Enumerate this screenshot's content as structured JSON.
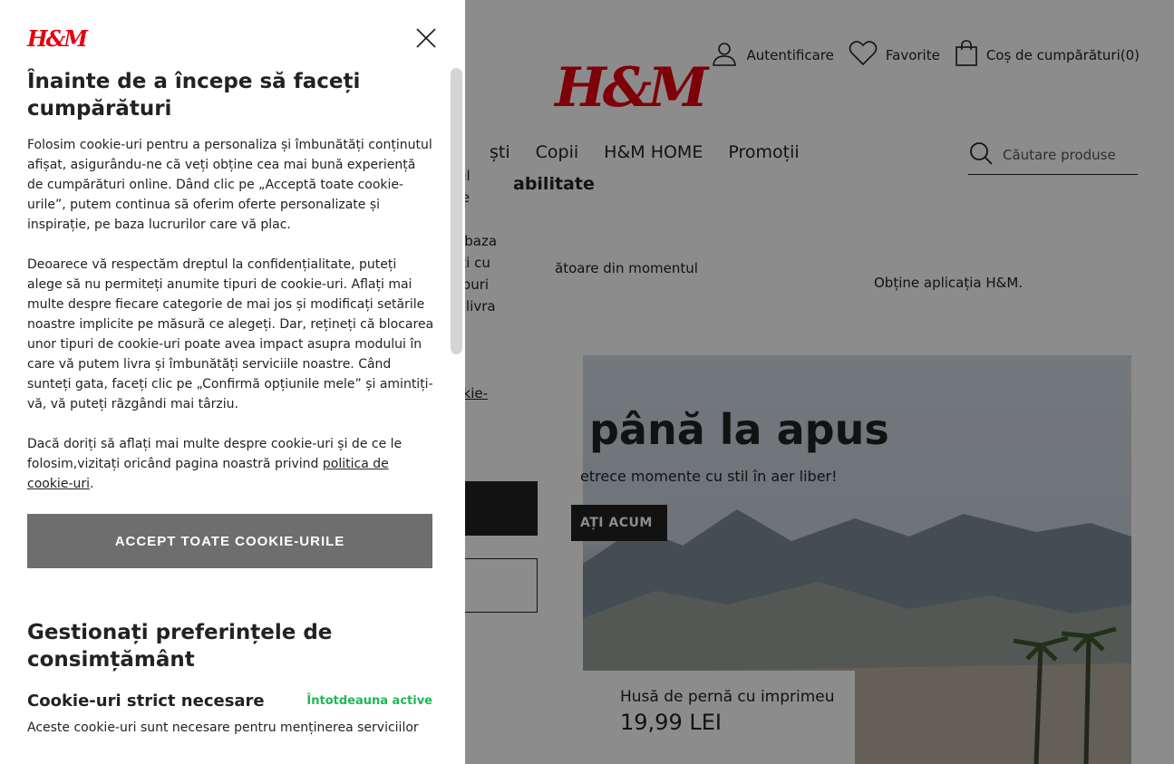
{
  "background": {
    "logo": "H&M",
    "top_links": [
      {
        "icon": "user-icon",
        "label": "Autentificare"
      },
      {
        "icon": "heart-icon",
        "label": "Favorite"
      },
      {
        "icon": "shopping-bag-icon",
        "label": "Coș de cumpărături(0)"
      }
    ],
    "nav": [
      "ști",
      "Copii",
      "H&M HOME",
      "Promoții"
    ],
    "nav_second": "abilitate",
    "search_placeholder": "Căutare produse",
    "partial_text_1": "ținutul\nnță de\nrile\",\ne, pe baza\ntinuați cu\nnor tipuri\nutem livra",
    "partial_text_2_a": "e",
    "partial_text_2_b": "a cookie-",
    "promo_text": "ătoare din momentul",
    "app_text": "Obține aplicația H&M.",
    "hero_title": "până la apus",
    "hero_subtitle": "etrece momente cu stil în aer liber!",
    "hero_button": "AȚI ACUM",
    "product_name": "Husă de pernă cu imprimeu",
    "product_price": "19,99 LEI"
  },
  "cookie_dialog": {
    "logo": "H&M",
    "title": "Înainte de a începe să faceți cumpărături",
    "paragraph_1": "Folosim cookie-uri pentru a personaliza și îmbunătăți conținutul afișat, asigurându-ne că veți obține cea mai bună experiență de cumpărături online. Dând clic pe „Acceptă toate cookie-urile”, putem continua să oferim oferte personalizate și inspirație, pe baza lucrurilor care vă plac.",
    "paragraph_2": "Deoarece vă respectăm dreptul la confidențialitate, puteți alege să nu permiteți anumite tipuri de cookie-uri. Aflați mai multe despre fiecare categorie de mai jos și modificați setările noastre implicite pe măsură ce alegeți. Dar, rețineți că blocarea unor tipuri de cookie-uri poate avea impact asupra modului în care vă putem livra și îmbunătăți serviciile noastre. Când sunteți gata, faceți clic pe „Confirmă opțiunile mele” și amintiți-vă, vă puteți răzgândi mai târziu.",
    "paragraph_3_text": "Dacă doriți să aflați mai multe despre cookie-uri și de ce le folosim,vizitați oricând pagina noastră privind ",
    "paragraph_3_link": "politica de cookie-uri",
    "paragraph_3_end": ".",
    "accept_button": "ACCEPT TOATE COOKIE-URILE",
    "manage_title": "Gestionați preferințele de consimțământ",
    "category": {
      "title": "Cookie-uri strict necesare",
      "status": "Întotdeauna active",
      "description": "Aceste cookie-uri sunt necesare pentru menținerea serviciilor"
    }
  }
}
